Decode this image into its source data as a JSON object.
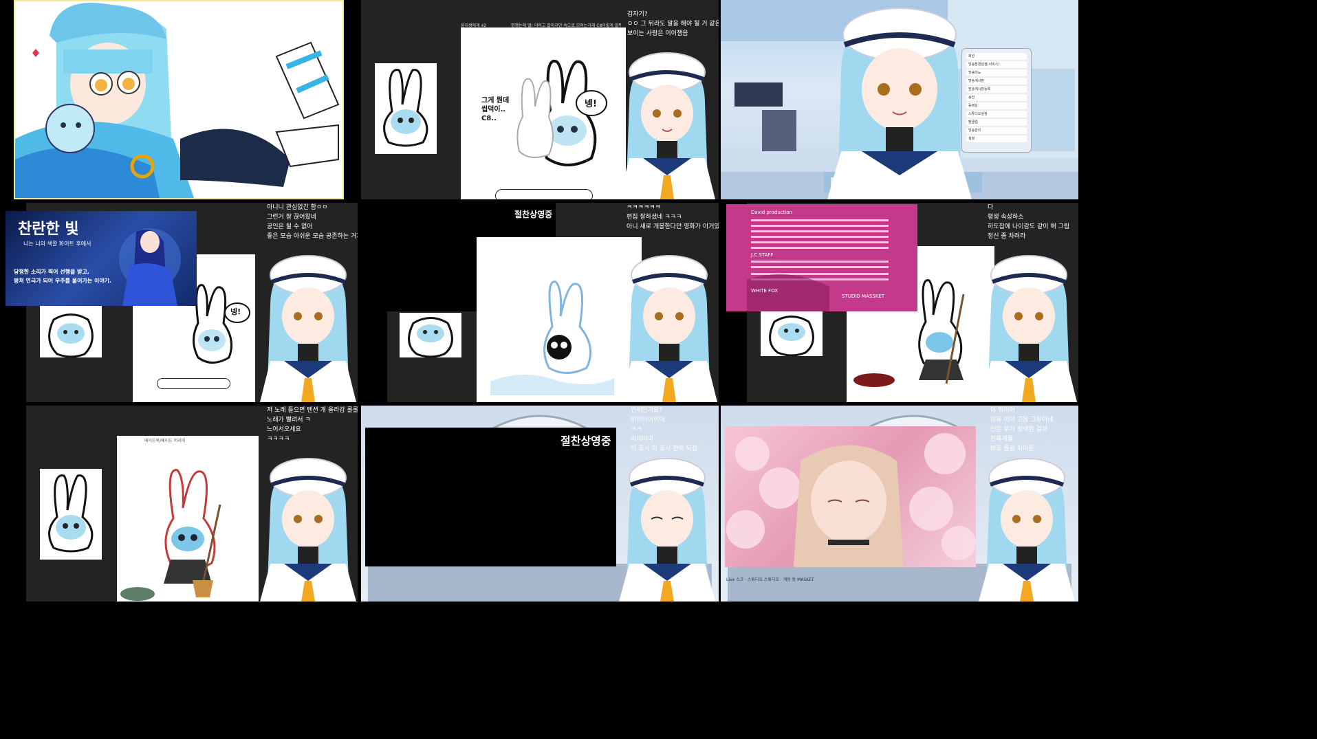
{
  "tiles": {
    "t2": {
      "caption_left": "움지생에게 42",
      "caption_right": "명쟁논에 멀! 이러고 잡아지만 속으로 모러는거래 C8이렇게 알뤄는거거든요",
      "chat": [
        "갑자기?",
        "ㅇㅇ 그 뒤라도 말을 해야 될 거 같은 게",
        "보이는 사람은 어이잼음"
      ],
      "bubble_left": "그게 뭔데\n씹덕이..\nC8..",
      "bubble_right": "넹!"
    },
    "t3": {
      "menu_items": [
        "회원",
        "방송환경설정(서비스)",
        "방송미뇨",
        "방송계시판",
        "방송게시판등록",
        "송전",
        "동영상",
        "스튜디오설정",
        "팬클럽",
        "방송관리",
        "설정"
      ]
    },
    "t4": {
      "banner_title": "찬란한 빛",
      "banner_sub": "너는 너의 색깔 화이트 후에서",
      "banner_body": "당쟁한 소리가 찍어 선행을 받고,\n뭉쳐 연극가 되어 우주를 울어가는 이야기.",
      "chat": [
        "아니니 관심없긴 함ㅇㅇ",
        "그런거 잘 끊어왔네",
        "공인은 될 수 없어",
        "좋은 모습 아쉬운 모습 공존하는 거지"
      ],
      "bubble": "넹!"
    },
    "t5": {
      "title": "절찬상영중",
      "chat": [
        "ㅋㅋㅋㅋㅋㅋ",
        "편집 잘하셨네 ㅋㅋㅋ",
        "아니 새로 개봉한다던 영화가 이거였네"
      ]
    },
    "t6": {
      "credits_header": "David production",
      "credits_line_1": "J.C.STAFF",
      "credits_line_2": "WHITE FOX",
      "credits_line_3": "STUDIO MASSKET",
      "chat": [
        "다",
        "평생 속상하소",
        "하도집에 나이감도 같이 해 그림",
        "정신 좀 차려라"
      ]
    },
    "t7": {
      "caption": "메이드복/메이드 머리띠",
      "chat": [
        "저 노래 들으면 텐션 개 올라감 롤롤 ㅋㅋ",
        "노래가 빨려서 ㅋ",
        "느어서오세요",
        "ㅋㅋㅋㅋ"
      ]
    },
    "t8": {
      "title": "절찬상영중",
      "chat": [
        "언제인가요?",
        "이이이이이이",
        "ㅋㅋ",
        "이이이이",
        "이 호시 이 호시 편히 되집"
      ]
    },
    "t9": {
      "chat": [
        "이 뭐이어",
        "이유 이야 고음 그뮤이네",
        "신은 무기 정색한 걸까",
        "진짜개꿀",
        "바로 틀을 되이문"
      ],
      "footer": "Live 스크 · 스튜디오 스튜디오 · 게등 동 MASKET"
    }
  },
  "colors": {
    "chat_text": "#ffffff",
    "grid_bg": "#000000",
    "panel_dark": "#2b2b2b",
    "accent_blue": "#7cc7e8",
    "hair_blue": "#9fd8ef",
    "credits_pink": "#c43a8a"
  }
}
